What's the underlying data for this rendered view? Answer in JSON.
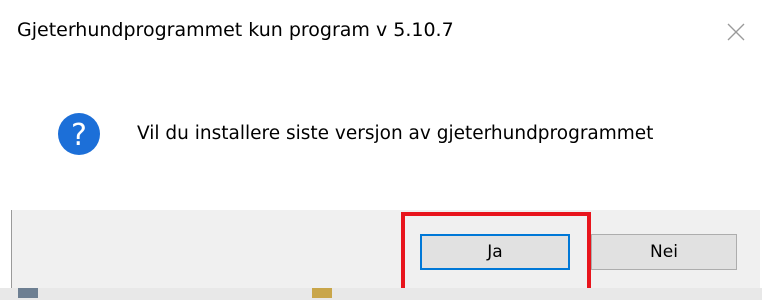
{
  "window": {
    "title": "Gjeterhundprogrammet kun program v 5.10.7",
    "close_icon": "close-icon"
  },
  "dialog": {
    "icon": "question-icon",
    "message": "Vil du installere siste versjon av gjeterhundprogrammet"
  },
  "buttons": {
    "yes_label": "Ja",
    "no_label": "Nei"
  },
  "colors": {
    "accent": "#0078d7",
    "question_icon": "#1c6fd8",
    "highlight": "#e8141c"
  }
}
